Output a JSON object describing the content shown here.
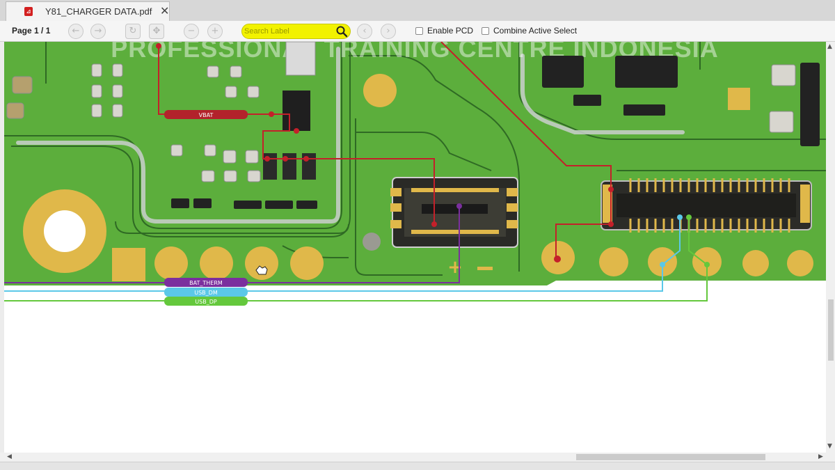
{
  "tab": {
    "title": "Y81_CHARGER DATA.pdf",
    "pdf_icon": "pdf-icon",
    "close_glyph": "✕"
  },
  "toolbar": {
    "page_label": "Page 1 / 1",
    "buttons": [
      "back-icon",
      "forward-icon",
      "rotate-icon",
      "move-icon",
      "zoom-out-icon",
      "zoom-in-icon"
    ],
    "search_placeholder": "Search Label",
    "enable_pcd_label": "Enable PCD",
    "combine_active_select_label": "Combine Active Select"
  },
  "board": {
    "watermark": "PROFESSIONAL TRAINING CENTRE INDONESIA",
    "nets": [
      {
        "name": "VBAT",
        "color": "#b3222b"
      },
      {
        "name": "BAT_THERM",
        "color": "#7b2f9e"
      },
      {
        "name": "USB_DM",
        "color": "#5bc8e8"
      },
      {
        "name": "USB_DP",
        "color": "#64c83c"
      }
    ],
    "pcb_color": "#5cae3c",
    "pad_color": "#e0b84a"
  }
}
